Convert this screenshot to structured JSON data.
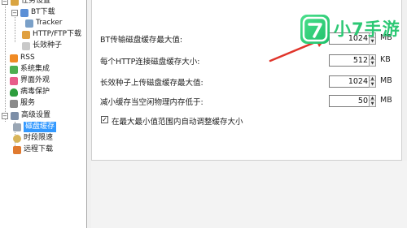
{
  "tree": {
    "items": [
      {
        "label": "任务设置"
      },
      {
        "label": "BT下载"
      },
      {
        "label": "Tracker"
      },
      {
        "label": "HTTP/FTP下载"
      },
      {
        "label": "长效种子"
      },
      {
        "label": "RSS"
      },
      {
        "label": "系统集成"
      },
      {
        "label": "界面外观"
      },
      {
        "label": "病毒保护"
      },
      {
        "label": "服务"
      },
      {
        "label": "高级设置"
      },
      {
        "label": "磁盘缓存"
      },
      {
        "label": "时段限速"
      },
      {
        "label": "远程下载"
      }
    ]
  },
  "settings": {
    "rows": [
      {
        "label": "BT传输磁盘缓存最大值:",
        "value": "1024",
        "unit": "MB"
      },
      {
        "label": "每个HTTP连接磁盘缓存大小:",
        "value": "512",
        "unit": "KB"
      },
      {
        "label": "长效种子上传磁盘缓存最大值:",
        "value": "1024",
        "unit": "MB"
      },
      {
        "label": "减小缓存当空闲物理内存低于:",
        "value": "50",
        "unit": "MB"
      }
    ],
    "auto_adjust": {
      "label": "在最大最小值范围内自动调整缓存大小",
      "checked": true,
      "mark": "✓"
    }
  },
  "spin": {
    "up": "▲",
    "down": "▼"
  },
  "watermark": {
    "text": "小7手游"
  },
  "colors": {
    "selected_bg": "#3399ff",
    "arrow": "#e0352b",
    "logo_green": "#2cc874"
  }
}
